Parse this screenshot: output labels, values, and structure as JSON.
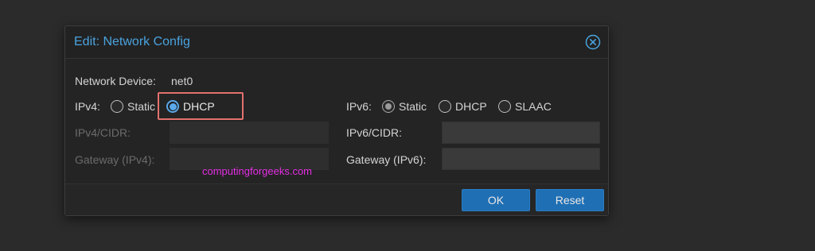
{
  "dialog": {
    "title": "Edit: Network Config",
    "close_icon": "close-circle-icon"
  },
  "form": {
    "network_device_label": "Network Device:",
    "network_device_value": "net0",
    "ipv4": {
      "label": "IPv4:",
      "options": [
        "Static",
        "DHCP"
      ],
      "selected": "DHCP",
      "cidr_label": "IPv4/CIDR:",
      "cidr_value": "",
      "gateway_label": "Gateway (IPv4):",
      "gateway_value": ""
    },
    "ipv6": {
      "label": "IPv6:",
      "options": [
        "Static",
        "DHCP",
        "SLAAC"
      ],
      "selected": "Static",
      "cidr_label": "IPv6/CIDR:",
      "cidr_value": "",
      "gateway_label": "Gateway (IPv6):",
      "gateway_value": ""
    }
  },
  "watermark": "computingforgeeks.com",
  "buttons": {
    "ok_label": "OK",
    "reset_label": "Reset"
  },
  "colors": {
    "accent": "#4aa3df",
    "highlight": "#e2716f",
    "button": "#1f6fb4",
    "watermark": "#e62ee6"
  }
}
